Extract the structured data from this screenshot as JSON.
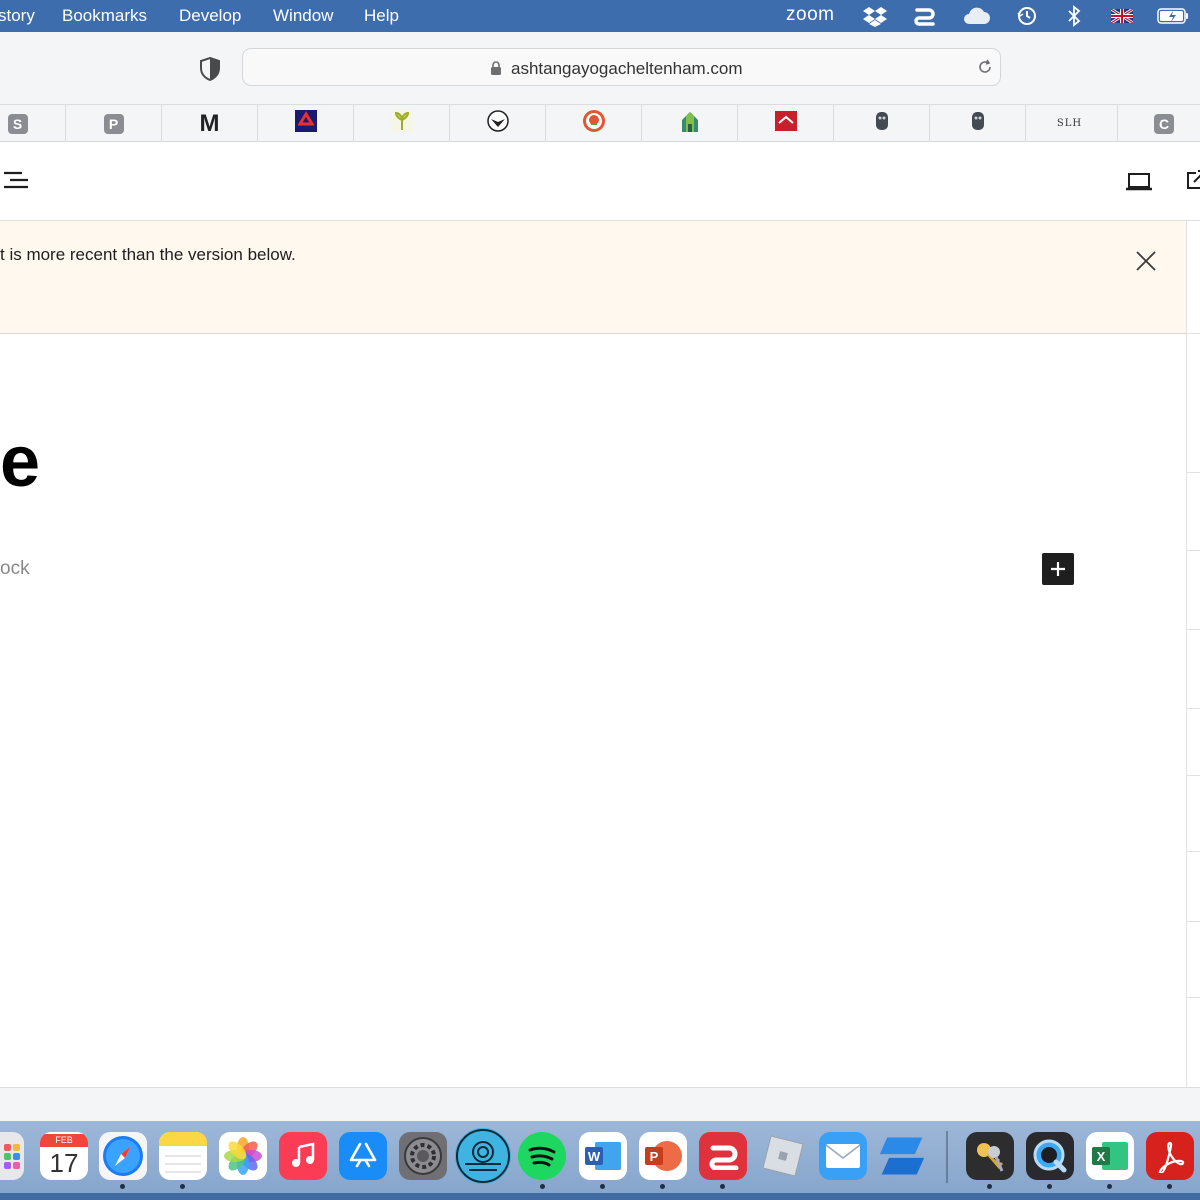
{
  "menubar": {
    "items": [
      "story",
      "Bookmarks",
      "Develop",
      "Window",
      "Help"
    ],
    "zoom_label": "zoom",
    "status_icons": [
      "dropbox-icon",
      "paper-icon",
      "icloud-icon",
      "time-machine-icon",
      "bluetooth-icon",
      "uk-flag-icon",
      "battery-icon"
    ]
  },
  "toolbar": {
    "url": "ashtangayogacheltenham.com"
  },
  "favorites": {
    "items": [
      {
        "kind": "letter",
        "label": "S"
      },
      {
        "kind": "letter",
        "label": "P"
      },
      {
        "kind": "text",
        "label": "M"
      },
      {
        "kind": "icon",
        "icon": "red-logo-icon",
        "color": "#1a1a6e"
      },
      {
        "kind": "icon",
        "icon": "sprout-icon",
        "color": "#c6d64a"
      },
      {
        "kind": "icon",
        "icon": "bird-icon",
        "color": "#222222"
      },
      {
        "kind": "icon",
        "icon": "duckduckgo-icon",
        "color": "#de5833"
      },
      {
        "kind": "icon",
        "icon": "temple-icon",
        "color": "#3a8a6e"
      },
      {
        "kind": "icon",
        "icon": "red-roof-icon",
        "color": "#c8202a"
      },
      {
        "kind": "icon",
        "icon": "owl-icon",
        "color": "#444a52"
      },
      {
        "kind": "icon",
        "icon": "owl-icon",
        "color": "#444a52"
      },
      {
        "kind": "slh",
        "label": "SLH"
      },
      {
        "kind": "letter",
        "label": "C"
      }
    ]
  },
  "notice": {
    "text": "t is more recent than the version below."
  },
  "editor": {
    "title_fragment": "e",
    "placeholder_fragment": "ock"
  },
  "colors": {
    "menubar": "#3e6dae",
    "notice_bg": "#fef8ee",
    "add_block_bg": "#1e1e1e"
  },
  "dock": {
    "calendar_month": "FEB",
    "calendar_day": "17",
    "apps": [
      {
        "name": "launchpad-app",
        "color": "#e8e8ea",
        "running": false
      },
      {
        "name": "calendar-app",
        "color": "#ffffff",
        "running": true
      },
      {
        "name": "safari-app",
        "color": "#1c7cf4",
        "running": true
      },
      {
        "name": "notes-app",
        "color": "#fbd645",
        "running": false
      },
      {
        "name": "photos-app",
        "color": "#ffffff",
        "running": false
      },
      {
        "name": "music-app",
        "color": "#fa3d54",
        "running": false
      },
      {
        "name": "app-store-app",
        "color": "#1a8cf8",
        "running": false
      },
      {
        "name": "system-preferences-app",
        "color": "#8c8c90",
        "running": false
      },
      {
        "name": "uploader-app",
        "color": "#3fb4e0",
        "running": false
      },
      {
        "name": "spotify-app",
        "color": "#1ed760",
        "running": true
      },
      {
        "name": "word-app",
        "color": "#2b5fb4",
        "running": true
      },
      {
        "name": "powerpoint-app",
        "color": "#d24726",
        "running": true
      },
      {
        "name": "paper-app",
        "color": "#e0323c",
        "running": true
      },
      {
        "name": "roblox-studio-app",
        "color": "#d9dde4",
        "running": false
      },
      {
        "name": "mail-app",
        "color": "#3aa0f5",
        "running": false
      },
      {
        "name": "blue-logo-app",
        "color": "#2b8ae8",
        "running": false
      },
      {
        "name": "keychain-app",
        "color": "#2d2d30",
        "running": true
      },
      {
        "name": "quicktime-app",
        "color": "#2a2a2e",
        "running": true
      },
      {
        "name": "excel-app",
        "color": "#1f7a45",
        "running": true
      },
      {
        "name": "acrobat-app",
        "color": "#d6211d",
        "running": true
      }
    ]
  }
}
